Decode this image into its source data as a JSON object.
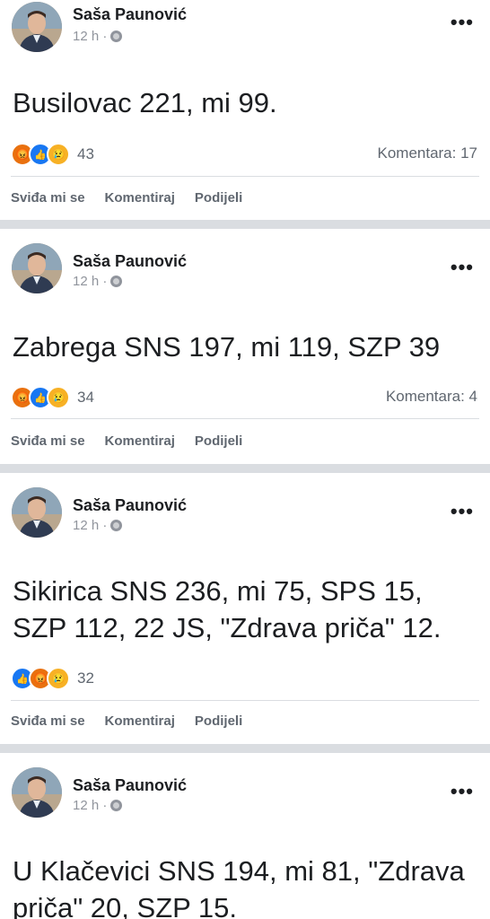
{
  "posts": [
    {
      "author": "Saša Paunović",
      "time": "12 h ·",
      "text": "Busilovac 221, mi 99.",
      "reactions": [
        "angry",
        "like",
        "sad"
      ],
      "reaction_count": "43",
      "comments": "Komentara: 17"
    },
    {
      "author": "Saša Paunović",
      "time": "12 h ·",
      "text": "Zabrega SNS 197, mi 119, SZP 39",
      "reactions": [
        "angry",
        "like",
        "sad"
      ],
      "reaction_count": "34",
      "comments": "Komentara: 4"
    },
    {
      "author": "Saša Paunović",
      "time": "12 h ·",
      "text": "Sikirica SNS 236, mi 75, SPS 15, SZP 112, 22 JS, \"Zdrava priča\" 12.",
      "reactions": [
        "like",
        "angry",
        "sad"
      ],
      "reaction_count": "32",
      "comments": ""
    },
    {
      "author": "Saša Paunović",
      "time": "12 h ·",
      "text": "U Klačevici SNS 194, mi 81, \"Zdrava priča\" 20, SZP 15.",
      "reactions": [],
      "reaction_count": "",
      "comments": ""
    }
  ],
  "actions": {
    "like": "Sviđa mi se",
    "comment": "Komentiraj",
    "share": "Podijeli"
  },
  "icons": {
    "more": "more-options-icon",
    "globe": "globe-icon",
    "angry": "angry-reaction-icon",
    "like": "like-reaction-icon",
    "sad": "sad-reaction-icon"
  },
  "colors": {
    "separator": "#dadde1",
    "like_blue": "#1877f2",
    "angry_orange": "#e9710f",
    "sad_yellow": "#f7b125"
  }
}
